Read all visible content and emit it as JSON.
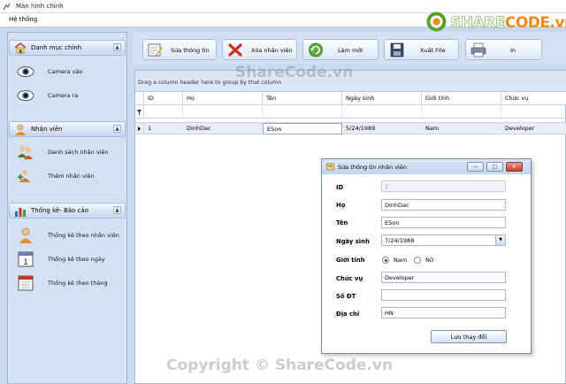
{
  "window": {
    "title": "Màn hình chính"
  },
  "menu": {
    "items": [
      {
        "label": "Hệ thống"
      }
    ]
  },
  "sidebar": {
    "groups": [
      {
        "label": "Danh mục chính",
        "items": [
          {
            "label": "Camera vào"
          },
          {
            "label": "Camera ra"
          }
        ]
      },
      {
        "label": "Nhân viên",
        "items": [
          {
            "label": "Danh sách nhân viên"
          },
          {
            "label": "Thêm nhân viên"
          }
        ]
      },
      {
        "label": "Thống kê- Báo cáo",
        "items": [
          {
            "label": "Thống kê theo nhân viên"
          },
          {
            "label": "Thống kê theo ngày"
          },
          {
            "label": "Thống kê theo tháng"
          }
        ]
      }
    ]
  },
  "toolbar": {
    "buttons": [
      {
        "label": "Sửa thông tin",
        "icon": "edit-form-icon"
      },
      {
        "label": "Xóa nhân viên",
        "icon": "delete-x-icon"
      },
      {
        "label": "Làm mới",
        "icon": "refresh-icon"
      },
      {
        "label": "Xuất FIle",
        "icon": "save-disk-icon"
      },
      {
        "label": "In",
        "icon": "printer-icon"
      }
    ]
  },
  "grid": {
    "group_panel_text": "Drag a column header here to group by that column",
    "columns": [
      "ID",
      "Họ",
      "Tên",
      "Ngày sinh",
      "Giới tính",
      "Chức vụ"
    ],
    "rows": [
      {
        "id": "1",
        "ho": "DinhDac",
        "ten": "ESon",
        "ngay_sinh": "5/24/1989",
        "gioi_tinh": "Nam",
        "chuc_vu": "Developer"
      }
    ]
  },
  "dialog": {
    "title": "Sửa thông tin nhân viên",
    "fields": {
      "id": {
        "label": "ID",
        "value": "1"
      },
      "ho": {
        "label": "Họ",
        "value": "DinhDac"
      },
      "ten": {
        "label": "Tên",
        "value": "ESon"
      },
      "ngay_sinh": {
        "label": "Ngày sinh",
        "value": "7/24/1988"
      },
      "gioi_tinh": {
        "label": "Giới tính",
        "options": [
          "Nam",
          "Nữ"
        ],
        "selected": "Nam"
      },
      "chuc_vu": {
        "label": "Chức vụ",
        "value": "Developer"
      },
      "so_dt": {
        "label": "Số ĐT",
        "value": ""
      },
      "dia_chi": {
        "label": "Địa chỉ",
        "value": "HN"
      }
    },
    "save_label": "Lưu thay đổi"
  },
  "branding": {
    "logo_text_part1": "SHARE",
    "logo_text_part2": "CODE.vn",
    "watermark_center": "ShareCode.vn",
    "watermark_bottom": "Copyright © ShareCode.vn",
    "colors": {
      "logo_green": "#5aa227",
      "logo_orange": "#f08a1c"
    }
  }
}
